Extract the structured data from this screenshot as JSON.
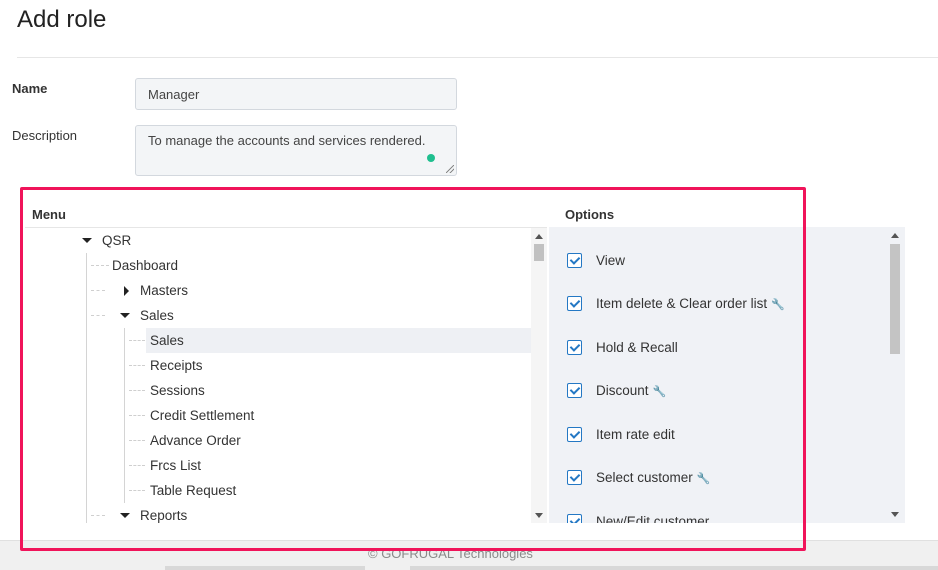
{
  "page": {
    "title": "Add role"
  },
  "form": {
    "name_label": "Name",
    "name_value": "Manager",
    "description_label": "Description",
    "description_value": "To manage the accounts and services rendered."
  },
  "menu_panel": {
    "header": "Menu",
    "tree": {
      "root": "QSR",
      "dashboard": "Dashboard",
      "masters": "Masters",
      "sales_group": "Sales",
      "sales_children": [
        "Sales",
        "Receipts",
        "Sessions",
        "Credit Settlement",
        "Advance Order",
        "Frcs List",
        "Table Request"
      ],
      "reports": "Reports"
    }
  },
  "options_panel": {
    "header": "Options",
    "options": [
      {
        "label": "View",
        "checked": true,
        "pin": false
      },
      {
        "label": "Item delete & Clear order list",
        "checked": true,
        "pin": true
      },
      {
        "label": "Hold & Recall",
        "checked": true,
        "pin": false
      },
      {
        "label": "Discount",
        "checked": true,
        "pin": true
      },
      {
        "label": "Item rate edit",
        "checked": true,
        "pin": false
      },
      {
        "label": "Select customer",
        "checked": true,
        "pin": true
      },
      {
        "label": "New/Edit customer",
        "checked": true,
        "pin": false
      }
    ]
  },
  "footer": {
    "copyright": "© GOFRUGAL Technologies"
  },
  "colors": {
    "highlight": "#f0145a",
    "checkbox": "#2478c4",
    "status_dot": "#1fbf8f",
    "options_bg": "#f0f2f6"
  }
}
